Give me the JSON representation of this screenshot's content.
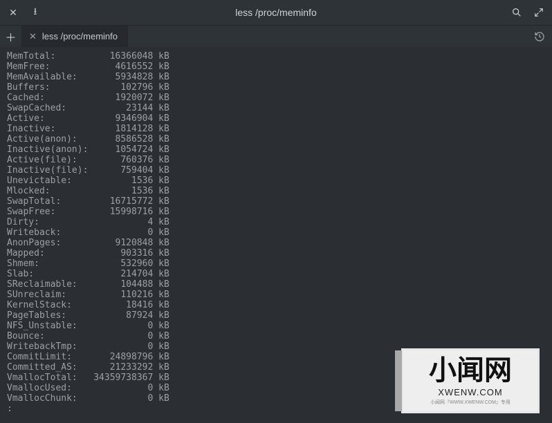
{
  "window": {
    "title": "less /proc/meminfo"
  },
  "tab": {
    "label": "less /proc/meminfo"
  },
  "prompt": ":",
  "meminfo": [
    {
      "key": "MemTotal:",
      "value": "16366048",
      "unit": "kB"
    },
    {
      "key": "MemFree:",
      "value": "4616552",
      "unit": "kB"
    },
    {
      "key": "MemAvailable:",
      "value": "5934828",
      "unit": "kB"
    },
    {
      "key": "Buffers:",
      "value": "102796",
      "unit": "kB"
    },
    {
      "key": "Cached:",
      "value": "1920072",
      "unit": "kB"
    },
    {
      "key": "SwapCached:",
      "value": "23144",
      "unit": "kB"
    },
    {
      "key": "Active:",
      "value": "9346904",
      "unit": "kB"
    },
    {
      "key": "Inactive:",
      "value": "1814128",
      "unit": "kB"
    },
    {
      "key": "Active(anon):",
      "value": "8586528",
      "unit": "kB"
    },
    {
      "key": "Inactive(anon):",
      "value": "1054724",
      "unit": "kB"
    },
    {
      "key": "Active(file):",
      "value": "760376",
      "unit": "kB"
    },
    {
      "key": "Inactive(file):",
      "value": "759404",
      "unit": "kB"
    },
    {
      "key": "Unevictable:",
      "value": "1536",
      "unit": "kB"
    },
    {
      "key": "Mlocked:",
      "value": "1536",
      "unit": "kB"
    },
    {
      "key": "SwapTotal:",
      "value": "16715772",
      "unit": "kB"
    },
    {
      "key": "SwapFree:",
      "value": "15998716",
      "unit": "kB"
    },
    {
      "key": "Dirty:",
      "value": "4",
      "unit": "kB"
    },
    {
      "key": "Writeback:",
      "value": "0",
      "unit": "kB"
    },
    {
      "key": "AnonPages:",
      "value": "9120848",
      "unit": "kB"
    },
    {
      "key": "Mapped:",
      "value": "903316",
      "unit": "kB"
    },
    {
      "key": "Shmem:",
      "value": "532960",
      "unit": "kB"
    },
    {
      "key": "Slab:",
      "value": "214704",
      "unit": "kB"
    },
    {
      "key": "SReclaimable:",
      "value": "104488",
      "unit": "kB"
    },
    {
      "key": "SUnreclaim:",
      "value": "110216",
      "unit": "kB"
    },
    {
      "key": "KernelStack:",
      "value": "18416",
      "unit": "kB"
    },
    {
      "key": "PageTables:",
      "value": "87924",
      "unit": "kB"
    },
    {
      "key": "NFS_Unstable:",
      "value": "0",
      "unit": "kB"
    },
    {
      "key": "Bounce:",
      "value": "0",
      "unit": "kB"
    },
    {
      "key": "WritebackTmp:",
      "value": "0",
      "unit": "kB"
    },
    {
      "key": "CommitLimit:",
      "value": "24898796",
      "unit": "kB"
    },
    {
      "key": "Committed_AS:",
      "value": "21233292",
      "unit": "kB"
    },
    {
      "key": "VmallocTotal:",
      "value": "34359738367",
      "unit": "kB"
    },
    {
      "key": "VmallocUsed:",
      "value": "0",
      "unit": "kB"
    },
    {
      "key": "VmallocChunk:",
      "value": "0",
      "unit": "kB"
    }
  ],
  "watermark": {
    "cn": "小闻网",
    "en": "XWENW.COM",
    "tiny": "小闻网『WWW.XWENW.COM』专用"
  }
}
